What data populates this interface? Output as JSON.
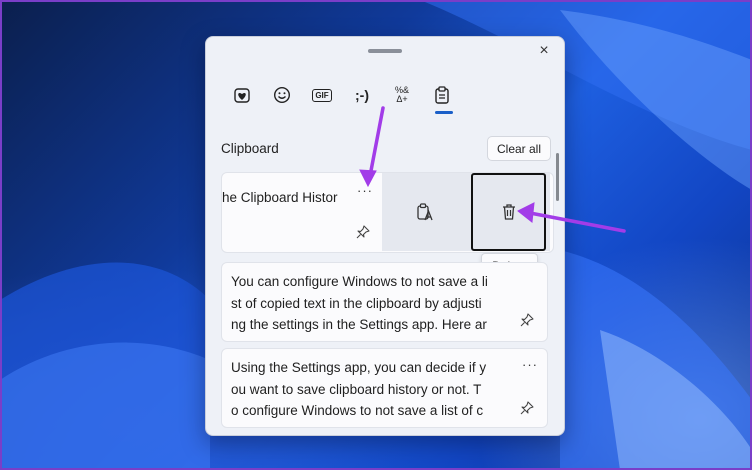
{
  "panel": {
    "close_icon": "×",
    "tabs": [
      {
        "name": "tab-stickers",
        "icon": "heart-sticker-icon"
      },
      {
        "name": "tab-emoji",
        "icon": "emoji-icon"
      },
      {
        "name": "tab-gif",
        "label": "GIF",
        "icon": "gif-icon"
      },
      {
        "name": "tab-kaomoji",
        "label": ";-)",
        "icon": "kaomoji-icon"
      },
      {
        "name": "tab-symbols",
        "label": "%&\nΔ+",
        "icon": "symbols-icon"
      },
      {
        "name": "tab-clipboard",
        "icon": "clipboard-icon",
        "selected": true
      }
    ],
    "section_title": "Clipboard",
    "clear_all_label": "Clear all",
    "items": [
      {
        "lines": [
          "he Clipboard Histor"
        ],
        "more": "···"
      },
      {
        "lines": [
          "You can configure Windows to not save a li",
          "st of copied text in the clipboard by adjusti",
          "ng the settings in the Settings app. Here ar"
        ],
        "more": "···"
      },
      {
        "lines": [
          "Using the Settings app, you can decide if y",
          "ou want to save clipboard history or not. T",
          "o configure Windows to not save a list of c"
        ],
        "more": "···"
      }
    ],
    "swipe_actions": [
      "paste-as-text-icon",
      "delete-icon"
    ],
    "tooltip": "Delete"
  },
  "colors": {
    "accent": "#1a5fc8",
    "annotation_arrow": "#a23ce8",
    "frame": "#7a3ec8"
  }
}
